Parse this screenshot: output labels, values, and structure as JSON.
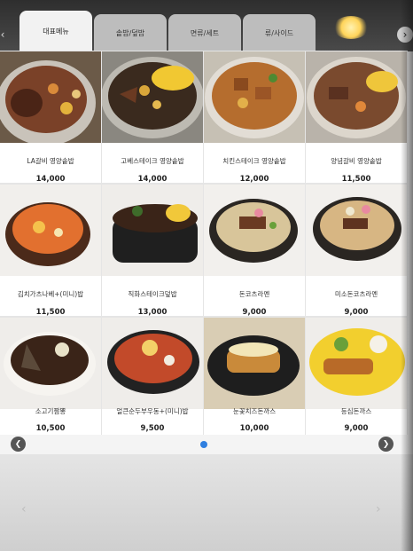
{
  "tabs": [
    {
      "label": "대표메뉴",
      "active": true
    },
    {
      "label": "솥밥/덮밥",
      "active": false
    },
    {
      "label": "면류/세트",
      "active": false
    },
    {
      "label": "류/사이드",
      "active": false
    }
  ],
  "nav": {
    "prev_icon": "chevron-left-icon",
    "next_icon": "chevron-right-icon"
  },
  "menu_items": [
    {
      "name": "LA갈비 영양솥밥",
      "price": "14,000",
      "image": "la-galbi-pot-rice"
    },
    {
      "name": "고베스테이크 영양솥밥",
      "price": "14,000",
      "image": "kobe-steak-pot-rice"
    },
    {
      "name": "치킨스테이크 영양솥밥",
      "price": "12,000",
      "image": "chicken-steak-pot-rice"
    },
    {
      "name": "양념갈비 영양솥밥",
      "price": "11,500",
      "image": "yangnyeom-galbi-pot-rice"
    },
    {
      "name": "김치가츠나베+(미니)밥",
      "price": "11,500",
      "image": "kimchi-katsu-nabe"
    },
    {
      "name": "직화스테이크덮밥",
      "price": "13,000",
      "image": "steak-rice-bowl"
    },
    {
      "name": "돈코츠라멘",
      "price": "9,000",
      "image": "tonkotsu-ramen"
    },
    {
      "name": "미소돈코츠라멘",
      "price": "9,000",
      "image": "miso-tonkotsu-ramen"
    },
    {
      "name": "소고기짬뽕",
      "price": "10,500",
      "image": "beef-jjamppong"
    },
    {
      "name": "얼큰순두부우동+(미니)밥",
      "price": "9,500",
      "image": "sundubu-udon"
    },
    {
      "name": "눈꽃치즈돈까스",
      "price": "10,000",
      "image": "cheese-donkatsu"
    },
    {
      "name": "등심돈까스",
      "price": "9,000",
      "image": "pork-loin-cutlet"
    }
  ],
  "pagination": {
    "current_page": 1,
    "total_pages": 1
  },
  "colors": {
    "tab_active": "#f2f2f2",
    "tab_inactive": "#bdbdbd",
    "page_dot": "#2f7fe0"
  }
}
